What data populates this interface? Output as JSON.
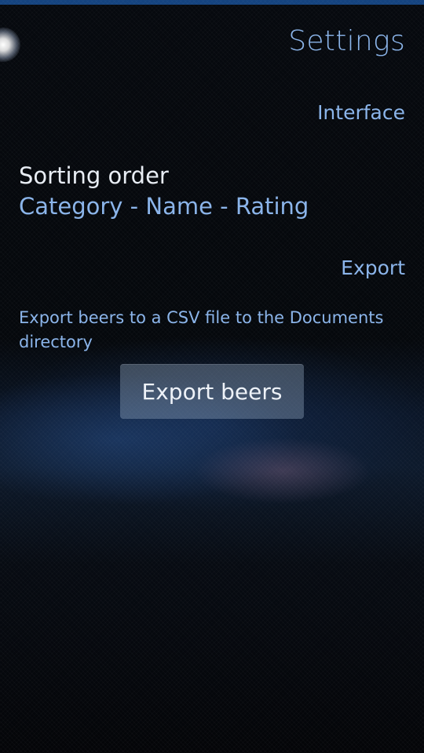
{
  "page": {
    "title": "Settings"
  },
  "sections": {
    "interface": {
      "header": "Interface",
      "sorting": {
        "label": "Sorting order",
        "value": "Category - Name - Rating"
      }
    },
    "export": {
      "header": "Export",
      "description": "Export beers to a CSV file to the Documents directory",
      "button_label": "Export beers"
    }
  },
  "colors": {
    "accent": "#8ab4ea",
    "primary_text": "#e8edf4",
    "top_bar": "#14437f"
  }
}
